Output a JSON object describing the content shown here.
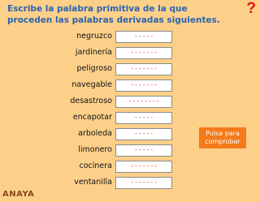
{
  "instruction": "Escribe la palabra primitiva de la que proceden las palabras derivadas siguientes.",
  "help_icon": "?",
  "rows": [
    {
      "word": "negruzco",
      "answer": "-----"
    },
    {
      "word": "jardinería",
      "answer": "-------"
    },
    {
      "word": "peligroso",
      "answer": "-------"
    },
    {
      "word": "navegable",
      "answer": "-------"
    },
    {
      "word": "desastroso",
      "answer": "--------"
    },
    {
      "word": "encapotar",
      "answer": "-----"
    },
    {
      "word": "arboleda",
      "answer": "-----"
    },
    {
      "word": "limonero",
      "answer": "-----"
    },
    {
      "word": "cocinera",
      "answer": "-------"
    },
    {
      "word": "ventanilla",
      "answer": "-------"
    }
  ],
  "check_button": "Pulsa para comprobar",
  "logo": "ANAYA"
}
